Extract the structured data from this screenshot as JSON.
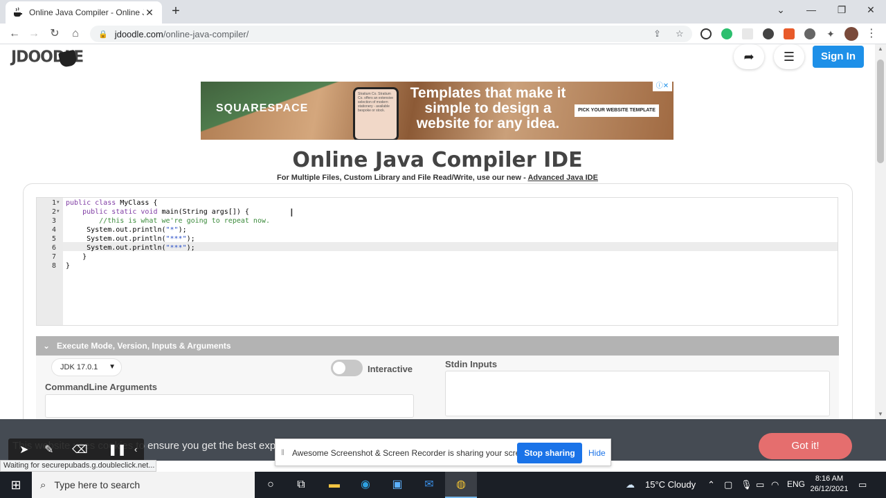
{
  "browser": {
    "tab_title": "Online Java Compiler - Online Ja",
    "url_host": "jdoodle.com",
    "url_path": "/online-java-compiler/",
    "new_tab": "+",
    "minimize": "⌄",
    "restore": "❐",
    "close": "✕"
  },
  "site": {
    "logo": "JDOODLE",
    "signin": "Sign In"
  },
  "ad": {
    "brand": "SQUARESPACE",
    "headline": "Templates that make it simple to design a website for any idea.",
    "cta": "PICK YOUR WEBSITE TEMPLATE",
    "phone_text": "Stratium Co. Stratium Co. offers an extensive selection of modern stationery - available bespoke or stock.",
    "adchoice": "ⓘ✕"
  },
  "header": {
    "title": "Online Java Compiler IDE",
    "subtitle": "For Multiple Files, Custom Library and File Read/Write, use our new - ",
    "advanced_link": "Advanced Java IDE"
  },
  "editor": {
    "lines": [
      {
        "n": "1",
        "code": "public class MyClass {"
      },
      {
        "n": "2",
        "code": "    public static void main(String args[]) {"
      },
      {
        "n": "3",
        "code": "        //this is what we're going to repeat now."
      },
      {
        "n": "4",
        "code": "     System.out.println(\"*\");"
      },
      {
        "n": "5",
        "code": "     System.out.println(\"***\");"
      },
      {
        "n": "6",
        "code": "     System.out.println(\"***\");"
      },
      {
        "n": "7",
        "code": "    }"
      },
      {
        "n": "8",
        "code": "}"
      }
    ]
  },
  "execute": {
    "section_title": "Execute Mode, Version, Inputs & Arguments",
    "jdk_version": "JDK 17.0.1",
    "interactive_label": "Interactive",
    "interactive_on": false,
    "stdin_label": "Stdin Inputs",
    "cmdline_label": "CommandLine Arguments"
  },
  "cookie": {
    "text": "This website uses cookies to ensure you get the best expe",
    "button": "Got it!"
  },
  "screen_share": {
    "message": "Awesome Screenshot & Screen Recorder is sharing your screen.",
    "stop": "Stop sharing",
    "hide": "Hide"
  },
  "status_bar": {
    "text": "Waiting for securepubads.g.doubleclick.net..."
  },
  "taskbar": {
    "search_placeholder": "Type here to search",
    "weather": "15°C  Cloudy",
    "language": "ENG",
    "time": "8:16 AM",
    "date": "26/12/2021"
  },
  "colors": {
    "accent_blue": "#1e90e8",
    "got_it": "#e56e6e",
    "cookie_bg": "#454b53"
  }
}
